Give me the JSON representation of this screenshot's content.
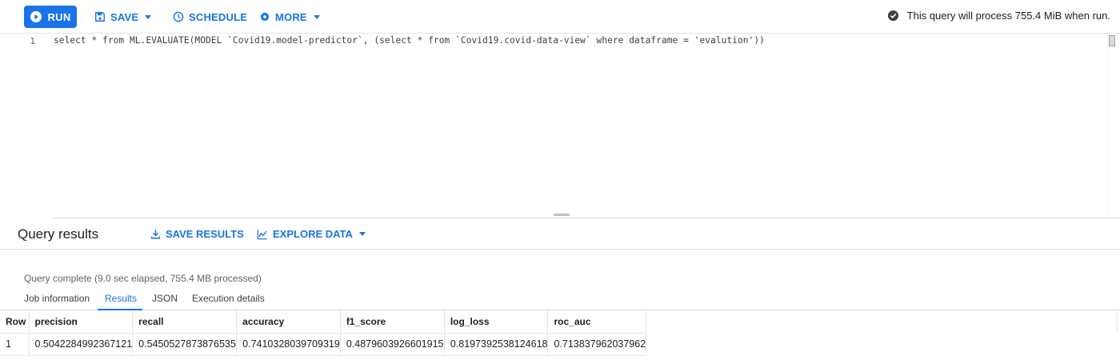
{
  "toolbar": {
    "run_label": "RUN",
    "save_label": "SAVE",
    "schedule_label": "SCHEDULE",
    "more_label": "MORE",
    "query_info": "This query will process 755.4 MiB when run."
  },
  "editor": {
    "line_number": "1",
    "code": "select * from ML.EVALUATE(MODEL `Covid19.model-predictor`, (select * from `Covid19.covid-data-view` where dataframe = 'evalution'))"
  },
  "results": {
    "title": "Query results",
    "save_results_label": "SAVE RESULTS",
    "explore_data_label": "EXPLORE DATA",
    "status": "Query complete (9.0 sec elapsed, 755.4 MB processed)",
    "tabs": [
      "Job information",
      "Results",
      "JSON",
      "Execution details"
    ],
    "active_tab": "Results",
    "columns": [
      "Row",
      "precision",
      "recall",
      "accuracy",
      "f1_score",
      "log_loss",
      "roc_auc"
    ],
    "rows": [
      [
        "1",
        "0.5042284992367121",
        "0.5450527873876535",
        "0.7410328039709319",
        "0.4879603926601915",
        "0.8197392538124618",
        "0.713837962037962"
      ]
    ]
  },
  "colors": {
    "accent": "#1a73e8",
    "text": "#202124",
    "muted": "#5f6368",
    "border": "#dadce0"
  },
  "icons": {
    "run": "play-circle-icon",
    "save": "save-icon",
    "schedule": "clock-icon",
    "more": "gear-icon",
    "query_info": "check-circle-icon",
    "save_results": "download-icon",
    "explore_data": "chart-icon"
  }
}
